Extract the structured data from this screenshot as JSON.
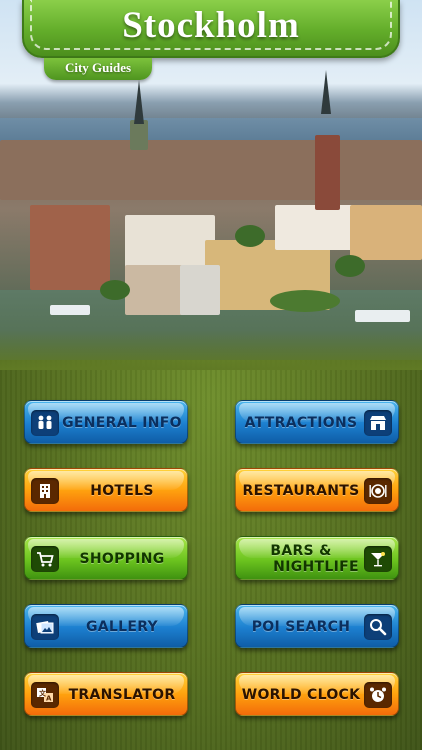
{
  "header": {
    "title": "Stockholm",
    "subtitle": "City Guides"
  },
  "menu": {
    "general_info": "GENERAL INFO",
    "attractions": "ATTRACTIONS",
    "hotels": "HOTELS",
    "restaurants": "RESTAURANTS",
    "shopping": "SHOPPING",
    "bars_nightlife_line1": "BARS &",
    "bars_nightlife_line2": "NIGHTLIFE",
    "gallery": "GALLERY",
    "poi_search": "POI SEARCH",
    "translator": "TRANSLATOR",
    "world_clock": "WORLD CLOCK"
  },
  "icons": {
    "general_info": "people-icon",
    "attractions": "storefront-icon",
    "hotels": "building-icon",
    "restaurants": "plate-cutlery-icon",
    "shopping": "cart-icon",
    "bars_nightlife": "cocktail-icon",
    "gallery": "photos-icon",
    "poi_search": "magnifier-icon",
    "translator": "translate-icon",
    "world_clock": "alarm-clock-icon"
  },
  "colors": {
    "banner_green": "#63ad2a",
    "button_blue": "#1c7fcf",
    "button_orange": "#ffa20e",
    "button_green": "#6cc41f"
  }
}
